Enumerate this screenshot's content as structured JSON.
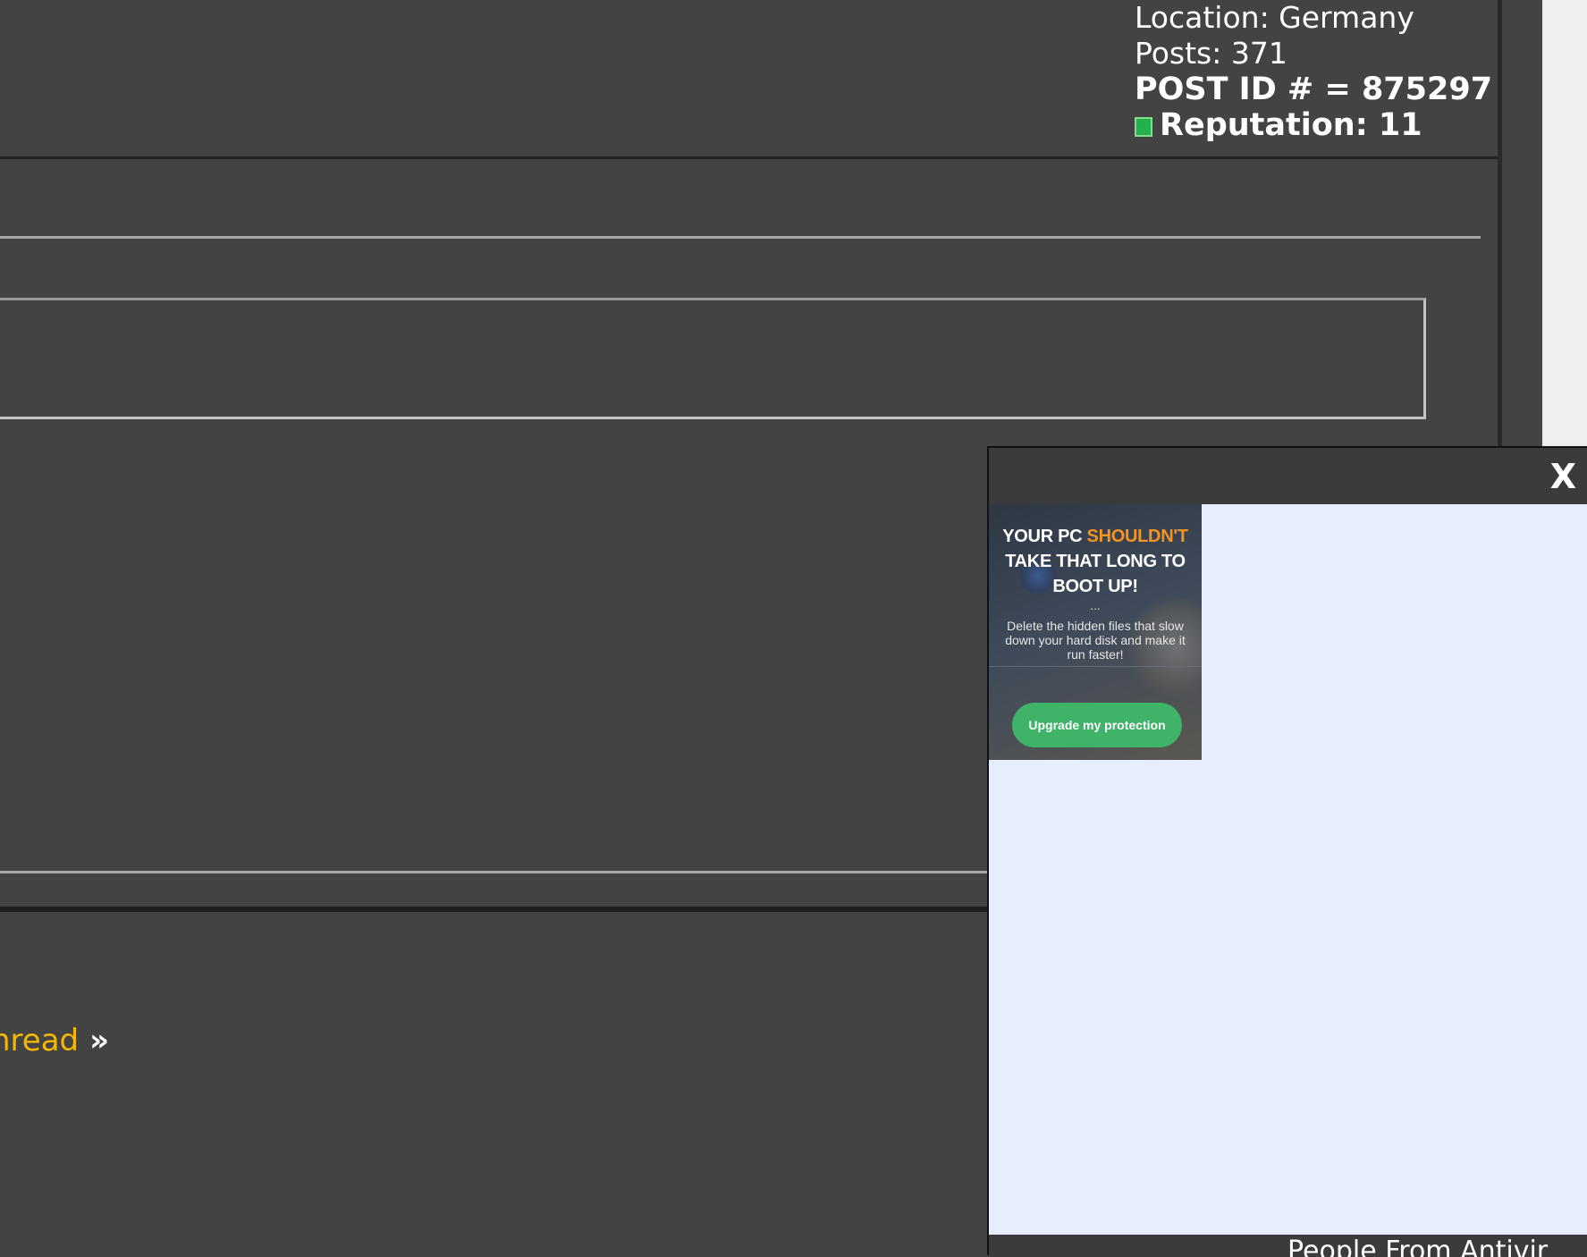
{
  "user_info": {
    "location": "Location: Germany",
    "posts": "Posts: 371",
    "post_id": "POST ID # = 875297",
    "reputation": "Reputation: 11"
  },
  "thread_nav": {
    "label": "hread",
    "arrows": "»"
  },
  "popup": {
    "close_label": "X",
    "ad": {
      "title_line1_prefix": "YOUR PC ",
      "title_line1_highlight": "SHOULDN'T",
      "title_line2": "TAKE THAT LONG TO",
      "title_line3": "BOOT UP!",
      "dots": "...",
      "subtitle": "Delete the hidden files that slow down your hard disk and make it run faster!",
      "cta": "Upgrade my protection"
    },
    "footer_text": "People From Antivir"
  },
  "colors": {
    "page_background": "#434343",
    "link_accent": "#f5b800",
    "reputation_badge": "#22b14c",
    "popup_background": "#e7edfd",
    "ad_highlight": "#f79321",
    "cta_button": "#3fb368"
  }
}
